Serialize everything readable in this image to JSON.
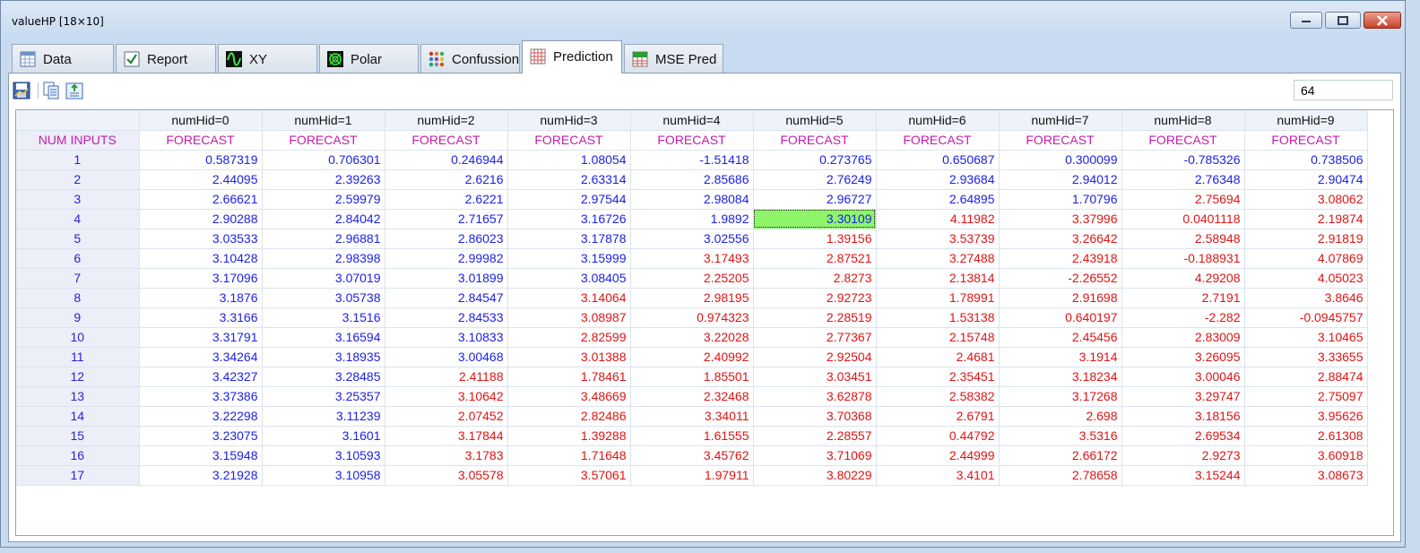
{
  "window": {
    "title": "valueHP [18×10]"
  },
  "tabs": [
    {
      "label": "Data",
      "icon": "table-icon"
    },
    {
      "label": "Report",
      "icon": "checkmark-icon"
    },
    {
      "label": "XY",
      "icon": "wave-chart-icon"
    },
    {
      "label": "Polar",
      "icon": "polar-chart-icon"
    },
    {
      "label": "Confussion",
      "icon": "dots-matrix-icon"
    },
    {
      "label": "Prediction",
      "icon": "grid-table-icon"
    },
    {
      "label": "MSE Pred",
      "icon": "mse-icon"
    }
  ],
  "active_tab": "Prediction",
  "toolbar": {
    "number_value": "64"
  },
  "grid": {
    "header": [
      "",
      "numHid=0",
      "numHid=1",
      "numHid=2",
      "numHid=3",
      "numHid=4",
      "numHid=5",
      "numHid=6",
      "numHid=7",
      "numHid=8",
      "numHid=9"
    ],
    "subheader": [
      "NUM INPUTS",
      "FORECAST",
      "FORECAST",
      "FORECAST",
      "FORECAST",
      "FORECAST",
      "FORECAST",
      "FORECAST",
      "FORECAST",
      "FORECAST",
      "FORECAST"
    ],
    "selected_cell": {
      "row": 4,
      "col": 6
    },
    "colors": {
      "blue": "#1c22e6",
      "red": "#e01414",
      "magenta": "#c51cb0",
      "selected": "#8ef56a"
    },
    "rows": [
      {
        "n": "1",
        "cells": [
          [
            "0.587319",
            "b"
          ],
          [
            "0.706301",
            "b"
          ],
          [
            "0.246944",
            "b"
          ],
          [
            "1.08054",
            "b"
          ],
          [
            "-1.51418",
            "b"
          ],
          [
            "0.273765",
            "b"
          ],
          [
            "0.650687",
            "b"
          ],
          [
            "0.300099",
            "b"
          ],
          [
            "-0.785326",
            "b"
          ],
          [
            "0.738506",
            "b"
          ]
        ]
      },
      {
        "n": "2",
        "cells": [
          [
            "2.44095",
            "b"
          ],
          [
            "2.39263",
            "b"
          ],
          [
            "2.6216",
            "b"
          ],
          [
            "2.63314",
            "b"
          ],
          [
            "2.85686",
            "b"
          ],
          [
            "2.76249",
            "b"
          ],
          [
            "2.93684",
            "b"
          ],
          [
            "2.94012",
            "b"
          ],
          [
            "2.76348",
            "b"
          ],
          [
            "2.90474",
            "b"
          ]
        ]
      },
      {
        "n": "3",
        "cells": [
          [
            "2.66621",
            "b"
          ],
          [
            "2.59979",
            "b"
          ],
          [
            "2.6221",
            "b"
          ],
          [
            "2.97544",
            "b"
          ],
          [
            "2.98084",
            "b"
          ],
          [
            "2.96727",
            "b"
          ],
          [
            "2.64895",
            "b"
          ],
          [
            "1.70796",
            "b"
          ],
          [
            "2.75694",
            "r"
          ],
          [
            "3.08062",
            "r"
          ]
        ]
      },
      {
        "n": "4",
        "cells": [
          [
            "2.90288",
            "b"
          ],
          [
            "2.84042",
            "b"
          ],
          [
            "2.71657",
            "b"
          ],
          [
            "3.16726",
            "b"
          ],
          [
            "1.9892",
            "b"
          ],
          [
            "3.30109",
            "b"
          ],
          [
            "4.11982",
            "r"
          ],
          [
            "3.37996",
            "r"
          ],
          [
            "0.0401118",
            "r"
          ],
          [
            "2.19874",
            "r"
          ]
        ]
      },
      {
        "n": "5",
        "cells": [
          [
            "3.03533",
            "b"
          ],
          [
            "2.96881",
            "b"
          ],
          [
            "2.86023",
            "b"
          ],
          [
            "3.17878",
            "b"
          ],
          [
            "3.02556",
            "b"
          ],
          [
            "1.39156",
            "r"
          ],
          [
            "3.53739",
            "r"
          ],
          [
            "3.26642",
            "r"
          ],
          [
            "2.58948",
            "r"
          ],
          [
            "2.91819",
            "r"
          ]
        ]
      },
      {
        "n": "6",
        "cells": [
          [
            "3.10428",
            "b"
          ],
          [
            "2.98398",
            "b"
          ],
          [
            "2.99982",
            "b"
          ],
          [
            "3.15999",
            "b"
          ],
          [
            "3.17493",
            "r"
          ],
          [
            "2.87521",
            "r"
          ],
          [
            "3.27488",
            "r"
          ],
          [
            "2.43918",
            "r"
          ],
          [
            "-0.188931",
            "r"
          ],
          [
            "4.07869",
            "r"
          ]
        ]
      },
      {
        "n": "7",
        "cells": [
          [
            "3.17096",
            "b"
          ],
          [
            "3.07019",
            "b"
          ],
          [
            "3.01899",
            "b"
          ],
          [
            "3.08405",
            "b"
          ],
          [
            "2.25205",
            "r"
          ],
          [
            "2.8273",
            "r"
          ],
          [
            "2.13814",
            "r"
          ],
          [
            "-2.26552",
            "r"
          ],
          [
            "4.29208",
            "r"
          ],
          [
            "4.05023",
            "r"
          ]
        ]
      },
      {
        "n": "8",
        "cells": [
          [
            "3.1876",
            "b"
          ],
          [
            "3.05738",
            "b"
          ],
          [
            "2.84547",
            "b"
          ],
          [
            "3.14064",
            "r"
          ],
          [
            "2.98195",
            "r"
          ],
          [
            "2.92723",
            "r"
          ],
          [
            "1.78991",
            "r"
          ],
          [
            "2.91698",
            "r"
          ],
          [
            "2.7191",
            "r"
          ],
          [
            "3.8646",
            "r"
          ]
        ]
      },
      {
        "n": "9",
        "cells": [
          [
            "3.3166",
            "b"
          ],
          [
            "3.1516",
            "b"
          ],
          [
            "2.84533",
            "b"
          ],
          [
            "3.08987",
            "r"
          ],
          [
            "0.974323",
            "r"
          ],
          [
            "2.28519",
            "r"
          ],
          [
            "1.53138",
            "r"
          ],
          [
            "0.640197",
            "r"
          ],
          [
            "-2.282",
            "r"
          ],
          [
            "-0.0945757",
            "r"
          ]
        ]
      },
      {
        "n": "10",
        "cells": [
          [
            "3.31791",
            "b"
          ],
          [
            "3.16594",
            "b"
          ],
          [
            "3.10833",
            "b"
          ],
          [
            "2.82599",
            "r"
          ],
          [
            "3.22028",
            "r"
          ],
          [
            "2.77367",
            "r"
          ],
          [
            "2.15748",
            "r"
          ],
          [
            "2.45456",
            "r"
          ],
          [
            "2.83009",
            "r"
          ],
          [
            "3.10465",
            "r"
          ]
        ]
      },
      {
        "n": "11",
        "cells": [
          [
            "3.34264",
            "b"
          ],
          [
            "3.18935",
            "b"
          ],
          [
            "3.00468",
            "b"
          ],
          [
            "3.01388",
            "r"
          ],
          [
            "2.40992",
            "r"
          ],
          [
            "2.92504",
            "r"
          ],
          [
            "2.4681",
            "r"
          ],
          [
            "3.1914",
            "r"
          ],
          [
            "3.26095",
            "r"
          ],
          [
            "3.33655",
            "r"
          ]
        ]
      },
      {
        "n": "12",
        "cells": [
          [
            "3.42327",
            "b"
          ],
          [
            "3.28485",
            "b"
          ],
          [
            "2.41188",
            "r"
          ],
          [
            "1.78461",
            "r"
          ],
          [
            "1.85501",
            "r"
          ],
          [
            "3.03451",
            "r"
          ],
          [
            "2.35451",
            "r"
          ],
          [
            "3.18234",
            "r"
          ],
          [
            "3.00046",
            "r"
          ],
          [
            "2.88474",
            "r"
          ]
        ]
      },
      {
        "n": "13",
        "cells": [
          [
            "3.37386",
            "b"
          ],
          [
            "3.25357",
            "b"
          ],
          [
            "3.10642",
            "r"
          ],
          [
            "3.48669",
            "r"
          ],
          [
            "2.32468",
            "r"
          ],
          [
            "3.62878",
            "r"
          ],
          [
            "2.58382",
            "r"
          ],
          [
            "3.17268",
            "r"
          ],
          [
            "3.29747",
            "r"
          ],
          [
            "2.75097",
            "r"
          ]
        ]
      },
      {
        "n": "14",
        "cells": [
          [
            "3.22298",
            "b"
          ],
          [
            "3.11239",
            "b"
          ],
          [
            "2.07452",
            "r"
          ],
          [
            "2.82486",
            "r"
          ],
          [
            "3.34011",
            "r"
          ],
          [
            "3.70368",
            "r"
          ],
          [
            "2.6791",
            "r"
          ],
          [
            "2.698",
            "r"
          ],
          [
            "3.18156",
            "r"
          ],
          [
            "3.95626",
            "r"
          ]
        ]
      },
      {
        "n": "15",
        "cells": [
          [
            "3.23075",
            "b"
          ],
          [
            "3.1601",
            "b"
          ],
          [
            "3.17844",
            "r"
          ],
          [
            "1.39288",
            "r"
          ],
          [
            "1.61555",
            "r"
          ],
          [
            "2.28557",
            "r"
          ],
          [
            "0.44792",
            "r"
          ],
          [
            "3.5316",
            "r"
          ],
          [
            "2.69534",
            "r"
          ],
          [
            "2.61308",
            "r"
          ]
        ]
      },
      {
        "n": "16",
        "cells": [
          [
            "3.15948",
            "b"
          ],
          [
            "3.10593",
            "b"
          ],
          [
            "3.1783",
            "r"
          ],
          [
            "1.71648",
            "r"
          ],
          [
            "3.45762",
            "r"
          ],
          [
            "3.71069",
            "r"
          ],
          [
            "2.44999",
            "r"
          ],
          [
            "2.66172",
            "r"
          ],
          [
            "2.9273",
            "r"
          ],
          [
            "3.60918",
            "r"
          ]
        ]
      },
      {
        "n": "17",
        "cells": [
          [
            "3.21928",
            "b"
          ],
          [
            "3.10958",
            "b"
          ],
          [
            "3.05578",
            "r"
          ],
          [
            "3.57061",
            "r"
          ],
          [
            "1.97911",
            "r"
          ],
          [
            "3.80229",
            "r"
          ],
          [
            "3.4101",
            "r"
          ],
          [
            "2.78658",
            "r"
          ],
          [
            "3.15244",
            "r"
          ],
          [
            "3.08673",
            "r"
          ]
        ]
      }
    ]
  }
}
